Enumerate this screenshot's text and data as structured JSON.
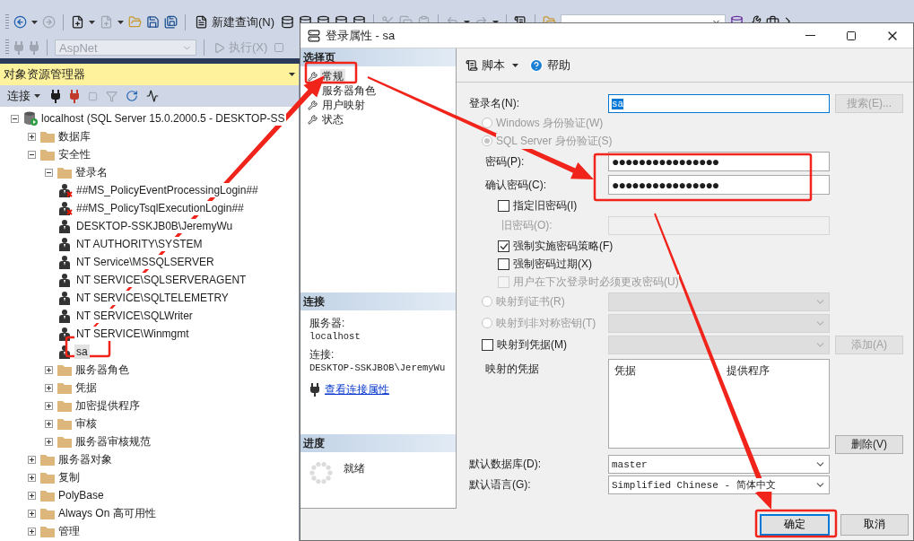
{
  "main_toolbar": {
    "new_query": "新建查询(N)"
  },
  "sql_toolbar": {
    "database": "AspNet",
    "execute": "执行(X)"
  },
  "object_explorer": {
    "title": "对象资源管理器",
    "connect": "连接",
    "tree": [
      {
        "label": "localhost (SQL Server 15.0.2000.5 - DESKTOP-SS",
        "kind": "server",
        "expanded": true,
        "selected": false,
        "children": [
          {
            "label": "数据库",
            "kind": "folder",
            "expanded": false,
            "selected": false
          },
          {
            "label": "安全性",
            "kind": "folder",
            "expanded": true,
            "selected": false,
            "children": [
              {
                "label": "登录名",
                "kind": "folder",
                "expanded": true,
                "selected": false,
                "children": [
                  {
                    "label": "##MS_PolicyEventProcessingLogin##",
                    "kind": "login",
                    "disabled": true,
                    "selected": false
                  },
                  {
                    "label": "##MS_PolicyTsqlExecutionLogin##",
                    "kind": "login",
                    "disabled": true,
                    "selected": false
                  },
                  {
                    "label": "DESKTOP-SSKJB0B\\JeremyWu",
                    "kind": "login",
                    "disabled": false,
                    "selected": false
                  },
                  {
                    "label": "NT AUTHORITY\\SYSTEM",
                    "kind": "login",
                    "disabled": false,
                    "selected": false
                  },
                  {
                    "label": "NT Service\\MSSQLSERVER",
                    "kind": "login",
                    "disabled": false,
                    "selected": false
                  },
                  {
                    "label": "NT SERVICE\\SQLSERVERAGENT",
                    "kind": "login",
                    "disabled": false,
                    "selected": false
                  },
                  {
                    "label": "NT SERVICE\\SQLTELEMETRY",
                    "kind": "login",
                    "disabled": false,
                    "selected": false
                  },
                  {
                    "label": "NT SERVICE\\SQLWriter",
                    "kind": "login",
                    "disabled": false,
                    "selected": false
                  },
                  {
                    "label": "NT SERVICE\\Winmgmt",
                    "kind": "login",
                    "disabled": false,
                    "selected": false
                  },
                  {
                    "label": "sa",
                    "kind": "login",
                    "disabled": false,
                    "selected": true
                  }
                ]
              },
              {
                "label": "服务器角色",
                "kind": "folder",
                "expanded": false,
                "selected": false
              },
              {
                "label": "凭据",
                "kind": "folder",
                "expanded": false,
                "selected": false
              },
              {
                "label": "加密提供程序",
                "kind": "folder",
                "expanded": false,
                "selected": false
              },
              {
                "label": "审核",
                "kind": "folder",
                "expanded": false,
                "selected": false
              },
              {
                "label": "服务器审核规范",
                "kind": "folder",
                "expanded": false,
                "selected": false
              }
            ]
          },
          {
            "label": "服务器对象",
            "kind": "folder",
            "expanded": false,
            "selected": false
          },
          {
            "label": "复制",
            "kind": "folder",
            "expanded": false,
            "selected": false
          },
          {
            "label": "PolyBase",
            "kind": "folder",
            "expanded": false,
            "selected": false
          },
          {
            "label": "Always On 高可用性",
            "kind": "folder",
            "expanded": false,
            "selected": false
          },
          {
            "label": "管理",
            "kind": "folder",
            "expanded": false,
            "selected": false
          }
        ]
      }
    ]
  },
  "dialog": {
    "title": "登录属性 - sa",
    "pages_header": "选择页",
    "pages": [
      {
        "label": "常规",
        "selected": true
      },
      {
        "label": "服务器角色",
        "selected": false
      },
      {
        "label": "用户映射",
        "selected": false
      },
      {
        "label": "状态",
        "selected": false
      }
    ],
    "connection_header": "连接",
    "server_label": "服务器:",
    "server": "localhost",
    "connection_label": "连接:",
    "connection": "DESKTOP-SSKJBOB\\JeremyWu",
    "connection_link": "查看连接属性",
    "progress_header": "进度",
    "progress_status": "就绪",
    "toolbar": {
      "script": "脚本",
      "help": "帮助"
    },
    "form": [
      {
        "kind": "text",
        "label": "登录名(N):",
        "value": "sa",
        "button": {
          "label": "搜索(E)...",
          "disabled": true
        }
      },
      {
        "kind": "radio",
        "label": "Windows 身份验证(W)",
        "selected": false,
        "disabled": true
      },
      {
        "kind": "radio",
        "label": "SQL Server 身份验证(S)",
        "selected": true,
        "disabled": true,
        "children": [
          {
            "kind": "password",
            "label": "密码(P):",
            "value": "●●●●●●●●●●●●●●●●",
            "disabled": false
          },
          {
            "kind": "password",
            "label": "确认密码(C):",
            "value": "●●●●●●●●●●●●●●●●",
            "disabled": false
          },
          {
            "kind": "checkbox",
            "label": "指定旧密码(I)",
            "checked": false,
            "disabled": false,
            "children": [
              {
                "kind": "password",
                "label": "旧密码(O):",
                "disabled": true
              }
            ]
          },
          {
            "kind": "checkbox",
            "label": "强制实施密码策略(F)",
            "checked": true,
            "disabled": false
          },
          {
            "kind": "checkbox",
            "label": "强制密码过期(X)",
            "checked": false,
            "disabled": false
          },
          {
            "kind": "checkbox",
            "label": "用户在下次登录时必须更改密码(U)",
            "checked": false,
            "disabled": true
          }
        ]
      },
      {
        "kind": "radio",
        "label": "映射到证书(R)",
        "selected": false,
        "disabled": true,
        "select": {
          "disabled": true
        }
      },
      {
        "kind": "radio",
        "label": "映射到非对称密钥(T)",
        "selected": false,
        "disabled": true,
        "select": {
          "disabled": true
        }
      },
      {
        "kind": "checkbox",
        "label": "映射到凭据(M)",
        "checked": false,
        "disabled": false,
        "select": {
          "disabled": true
        },
        "button": {
          "label": "添加(A)",
          "disabled": true
        },
        "children": [
          {
            "kind": "list",
            "label": "映射的凭据",
            "columns": [
              "凭据",
              "提供程序"
            ],
            "button": {
              "label": "删除(V)",
              "disabled": false
            }
          }
        ]
      },
      {
        "kind": "select",
        "label": "默认数据库(D):",
        "value": "master",
        "disabled": false
      },
      {
        "kind": "select",
        "label": "默认语言(G):",
        "value": "Simplified Chinese - 简体中文",
        "disabled": false
      }
    ],
    "buttons": [
      {
        "label": "确定",
        "default": true
      },
      {
        "label": "取消",
        "default": false
      }
    ]
  }
}
